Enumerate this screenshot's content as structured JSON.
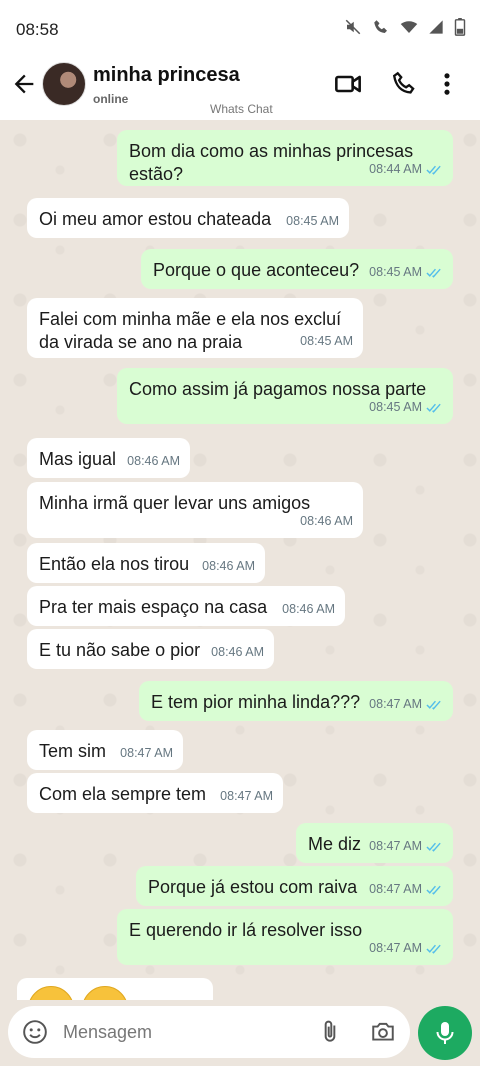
{
  "status_bar": {
    "time": "08:58"
  },
  "header": {
    "contact_name": "minha princesa",
    "contact_status": "online",
    "app_label": "Whats Chat"
  },
  "messages": [
    {
      "dir": "out",
      "text": "Bom dia como as minhas princesas\nestão?",
      "time": "08:44 AM",
      "read": true
    },
    {
      "dir": "in",
      "text": "Oi meu amor estou chateada",
      "time": "08:45 AM"
    },
    {
      "dir": "out",
      "text": "Porque o que aconteceu?",
      "time": "08:45 AM",
      "read": true
    },
    {
      "dir": "in",
      "text": "Falei com minha mãe e ela nos excluí\nda virada se ano na praia",
      "time": "08:45 AM"
    },
    {
      "dir": "out",
      "text": "Como assim já pagamos nossa parte",
      "time": "08:45 AM",
      "read": true
    },
    {
      "dir": "in",
      "text": "Mas igual",
      "time": "08:46 AM"
    },
    {
      "dir": "in",
      "text": "Minha irmã quer levar uns amigos",
      "time": "08:46 AM"
    },
    {
      "dir": "in",
      "text": "Então ela nos tirou",
      "time": "08:46 AM"
    },
    {
      "dir": "in",
      "text": "Pra ter mais espaço na casa",
      "time": "08:46 AM"
    },
    {
      "dir": "in",
      "text": "E tu não sabe o pior",
      "time": "08:46 AM"
    },
    {
      "dir": "out",
      "text": "E tem pior minha linda???",
      "time": "08:47 AM",
      "read": true
    },
    {
      "dir": "in",
      "text": "Tem sim",
      "time": "08:47 AM"
    },
    {
      "dir": "in",
      "text": "Com ela sempre tem",
      "time": "08:47 AM"
    },
    {
      "dir": "out",
      "text": "Me diz",
      "time": "08:47 AM",
      "read": true
    },
    {
      "dir": "out",
      "text": "Porque já estou com raiva",
      "time": "08:47 AM",
      "read": true
    },
    {
      "dir": "out",
      "text": "E querendo ir lá resolver isso",
      "time": "08:47 AM",
      "read": true
    }
  ],
  "composer": {
    "placeholder": "Mensagem"
  },
  "colors": {
    "outgoing_bubble": "#d9fdd3",
    "incoming_bubble": "#ffffff",
    "chat_background": "#ece5dd",
    "mic_button": "#1daa61",
    "read_tick": "#53bdeb"
  }
}
